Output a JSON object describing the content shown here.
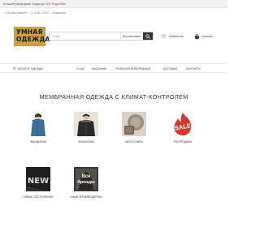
{
  "topbar": {
    "promo_text": "Большая распродажа! Скидки до 70%.",
    "promo_link": "Подробнее"
  },
  "contacts": {
    "account": "Личный кабинет",
    "hours": "10:00 - 22:00 — ежедневно"
  },
  "header": {
    "logo_line1": "УМНАЯ",
    "logo_line2": "ОДЕЖДА",
    "search_placeholder": "Поиск",
    "category_select": "Все категории",
    "favorites_label": "Избранное",
    "cart_label": "Корзина"
  },
  "nav": {
    "catalog": "КАТАЛОГ ОДЕЖДЫ",
    "items": [
      "О НАС",
      "МАГАЗИНЫ",
      "ПОЛЕЗНАЯ ИНФОРМАЦИЯ",
      "ДОСТАВКА",
      "КОНТАКТЫ"
    ]
  },
  "main": {
    "title": "МЕМБРАННАЯ ОДЕЖДА С КЛИМАТ-КОНТРОЛЕМ",
    "categories": [
      {
        "label": "ЖЕНЩИНАМ",
        "icon": "woman-coat-photo"
      },
      {
        "label": "МУЖЧИНАМ",
        "icon": "man-jacket-photo"
      },
      {
        "label": "АКСЕССУАРЫ",
        "icon": "accessories-photo"
      },
      {
        "label": "РАСПРОДАЖА",
        "icon": "sale-flame-icon",
        "badge": "SALE"
      },
      {
        "label": "НОВЫЕ ПОСТУПЛЕНИЯ",
        "icon": "new-arrivals-icon",
        "badge": "NEW"
      },
      {
        "label": "НАШИ ПРОИЗВОДИТЕЛИ",
        "icon": "brands-photo",
        "badge_line1": "Все",
        "badge_line2": "бренды"
      }
    ]
  },
  "colors": {
    "logo_bg": "#c9a23b",
    "sale_red": "#d33a2c",
    "promo_red": "#c0392b",
    "dark_button": "#333333"
  }
}
